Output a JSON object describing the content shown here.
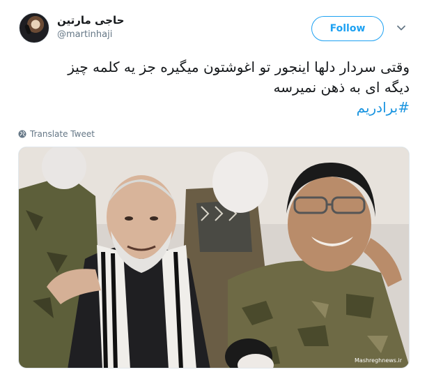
{
  "author": {
    "display_name": "حاجی مارتین",
    "handle": "@martinhaji"
  },
  "actions": {
    "follow_label": "Follow",
    "menu_icon": "chevron-down-icon"
  },
  "tweet": {
    "lines": [
      "وقتی سردار دلها اینجور تو اغوشتون میگیره جز یه کلمه چیز",
      "دیگه ای به ذهن نمیرسه"
    ],
    "hashtag": "#برادریم"
  },
  "translate": {
    "label": "Translate Tweet",
    "icon": "globe-icon"
  },
  "media": {
    "watermark": "Mashreghnews.ir"
  },
  "colors": {
    "accent": "#1da1f2",
    "hashtag": "#1b95e0",
    "muted": "#657786",
    "text": "#14171a",
    "border": "#e1e8ed"
  }
}
